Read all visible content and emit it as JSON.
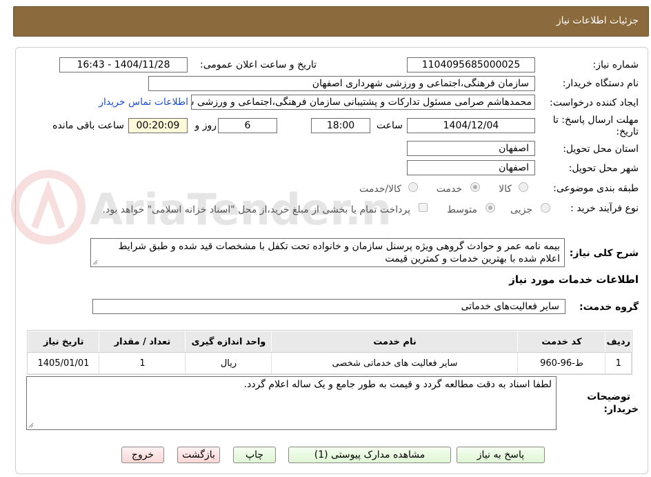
{
  "header": {
    "title": "جزئیات اطلاعات نیاز"
  },
  "fields": {
    "need_number_label": "شماره نیاز:",
    "need_number": "1104095685000025",
    "announce_label": "تاریخ و ساعت اعلان عمومی:",
    "announce_value": "1404/11/28 - 16:43",
    "buyer_org_label": "نام دستگاه خریدار:",
    "buyer_org": "سازمان فرهنگی،اجتماعی و ورزشی شهرداری اصفهان",
    "requester_label": "ایجاد کننده درخواست:",
    "requester": "محمدهاشم صرامی مسئول تدارکات و پشتیبانی سازمان فرهنگی،اجتماعی و ورزشی شهرداری اصفهان",
    "contact_link": "اطلاعات تماس خریدار",
    "deadline_label_1": "مهلت ارسال پاسخ: تا",
    "deadline_label_2": "تاریخ:",
    "deadline_date": "1404/12/04",
    "time_label": "ساعت",
    "deadline_time": "18:00",
    "days": "6",
    "days_label": "روز و",
    "remaining": "00:20:09",
    "remaining_label": "ساعت باقی مانده",
    "province_label": "استان محل تحویل:",
    "province": "اصفهان",
    "city_label": "شهر محل تحویل:",
    "city": "اصفهان",
    "category_label": "طبقه بندی موضوعی:",
    "category_options": [
      "کالا",
      "خدمت",
      "کالا/خدمت"
    ],
    "category_selected": "خدمت",
    "process_label": "نوع فرآیند خرید :",
    "process_options": [
      "جزیی",
      "متوسط"
    ],
    "process_selected": "متوسط",
    "payment_note": "پرداخت تمام یا بخشی از مبلغ خرید،از محل \"اسناد خزانه اسلامی\" خواهد بود."
  },
  "summary": {
    "label": "شرح کلی نیاز:",
    "text": "بیمه نامه  عمر و حوادث گروهی ویژه پرسنل سازمان و خانواده تحت تکفل با مشخصات قید شده و طبق شرایط اعلام شده  با بهترین خدمات و کمترین قیمت"
  },
  "services": {
    "section_title": "اطلاعات خدمات مورد نیاز",
    "group_label": "گروه خدمت:",
    "group_value": "سایر فعالیت‌های خدماتی",
    "columns": [
      "ردیف",
      "کد خدمت",
      "نام خدمت",
      "واحد اندازه گیری",
      "تعداد / مقدار",
      "تاریخ نیاز"
    ],
    "rows": [
      [
        "1",
        "ط-96-960",
        "سایر فعالیت های خدماتی شخصی",
        "ریال",
        "1",
        "1405/01/01"
      ]
    ]
  },
  "notes": {
    "label_1": "توضیحات",
    "label_2": "خریدار:",
    "text": "لطفا اسناد به دقت مطالعه گردد و قیمت به طور جامع و یک ساله اعلام گردد."
  },
  "buttons": {
    "reply": "پاسخ به نیاز",
    "attachments": "مشاهده مدارک پیوستی (1)",
    "print": "چاپ",
    "back": "بازگشت",
    "exit": "خروج"
  },
  "watermark_text": "AriaTender.neT"
}
